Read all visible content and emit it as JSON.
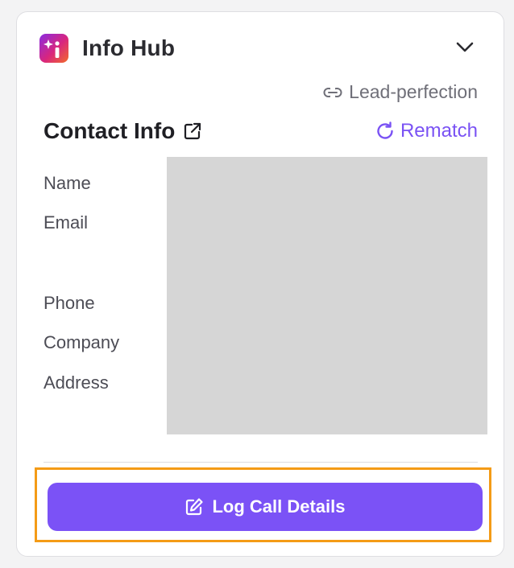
{
  "header": {
    "title": "Info Hub",
    "logo_icon": "sparkle-info-logo",
    "collapse_icon": "chevron-down-icon"
  },
  "lead": {
    "label": "Lead-perfection",
    "icon": "link-icon"
  },
  "contact": {
    "title": "Contact Info",
    "external_icon": "external-link-icon",
    "rematch_label": "Rematch",
    "rematch_icon": "refresh-icon",
    "fields": [
      {
        "label": "Name"
      },
      {
        "label": "Email"
      },
      {
        "label": "Phone"
      },
      {
        "label": "Company"
      },
      {
        "label": "Address"
      }
    ]
  },
  "actions": {
    "log_call_label": "Log Call Details",
    "log_call_icon": "edit-icon"
  },
  "colors": {
    "accent": "#7b52f6",
    "highlight": "#f49b16",
    "redacted": "#d6d6d6"
  }
}
